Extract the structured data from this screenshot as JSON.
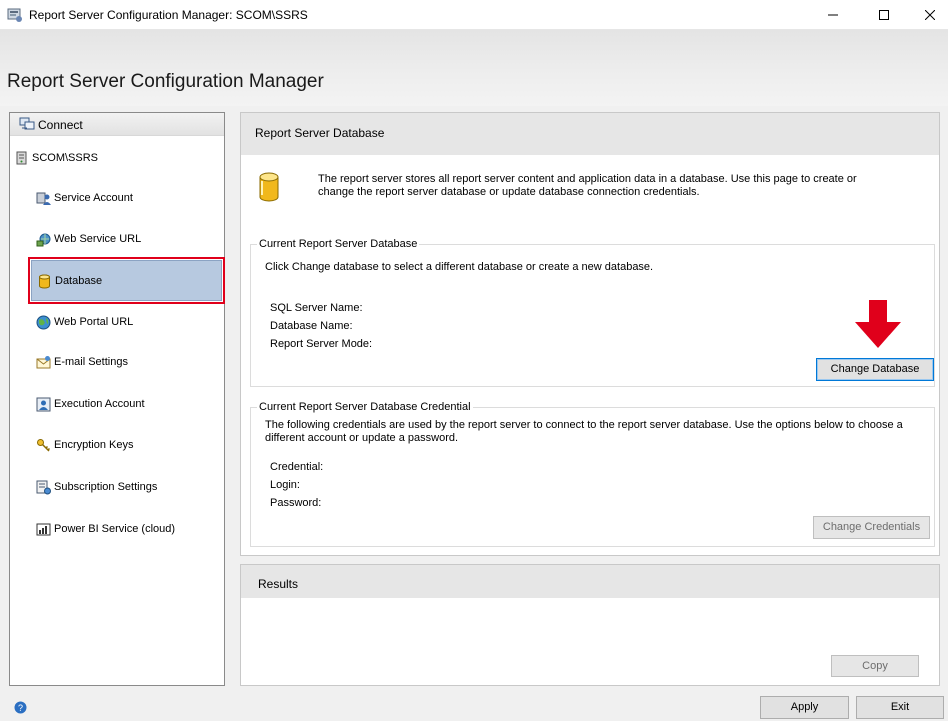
{
  "window": {
    "title": "Report Server Configuration Manager: SCOM\\SSRS",
    "controls": {
      "minimize": "minimize",
      "maximize": "maximize",
      "close": "close"
    }
  },
  "header": {
    "title": "Report Server Configuration Manager"
  },
  "sidebar": {
    "connect_label": "Connect",
    "server_name": "SCOM\\SSRS",
    "selected": "Database",
    "items": [
      {
        "label": "Service Account",
        "icon": "service-account-icon"
      },
      {
        "label": "Web Service URL",
        "icon": "web-service-url-icon"
      },
      {
        "label": "Database",
        "icon": "database-icon"
      },
      {
        "label": "Web Portal URL",
        "icon": "globe-icon"
      },
      {
        "label": "E-mail Settings",
        "icon": "email-icon"
      },
      {
        "label": "Execution Account",
        "icon": "execution-account-icon"
      },
      {
        "label": "Encryption Keys",
        "icon": "keys-icon"
      },
      {
        "label": "Subscription Settings",
        "icon": "subscription-icon"
      },
      {
        "label": "Power BI Service (cloud)",
        "icon": "power-bi-icon"
      }
    ]
  },
  "main": {
    "title": "Report Server Database",
    "description_line1": "The report server stores all report server content and application data in a database. Use this page to create or",
    "description_line2": "change the report server database or update database connection credentials.",
    "current_db": {
      "legend": "Current Report Server Database",
      "instruction": "Click Change database to select a different database or create a new database.",
      "sql_server_label": "SQL Server Name:",
      "database_name_label": "Database Name:",
      "report_server_mode_label": "Report Server Mode:",
      "change_button": "Change Database"
    },
    "credential": {
      "legend": "Current Report Server Database Credential",
      "description_line1": "The following credentials are used by the report server to connect to the report server database.  Use the options below to choose a",
      "description_line2": "different account or update a password.",
      "credential_label": "Credential:",
      "login_label": "Login:",
      "password_label": "Password:",
      "change_button": "Change Credentials"
    }
  },
  "results": {
    "title": "Results",
    "copy_button": "Copy"
  },
  "footer": {
    "apply_button": "Apply",
    "exit_button": "Exit"
  },
  "colors": {
    "selection": "#b7c9e0",
    "highlight_border": "#e0001b",
    "arrow": "#e0001b",
    "focus_border": "#0078d7"
  }
}
